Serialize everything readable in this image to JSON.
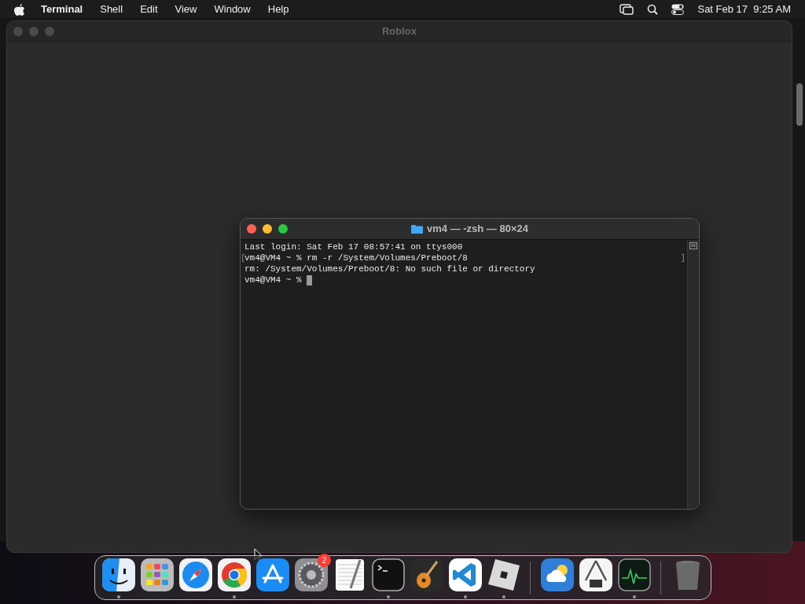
{
  "menu_bar": {
    "app_name": "Terminal",
    "menus": [
      "Shell",
      "Edit",
      "View",
      "Window",
      "Help"
    ],
    "clock": "Sat Feb 17  9:25 AM"
  },
  "background_window": {
    "title": "Roblox"
  },
  "terminal": {
    "title": "vm4 — -zsh — 80×24",
    "cursor": true,
    "lines": [
      {
        "text": "Last login: Sat Feb 17 08:57:41 on ttys000"
      },
      {
        "text": "vm4@VM4 ~ % rm -r /System/Volumes/Preboot/8",
        "open_mark": "[",
        "close_mark": "]"
      },
      {
        "text": "rm: /System/Volumes/Preboot/8: No such file or directory"
      },
      {
        "text": "vm4@VM4 ~ % "
      }
    ]
  },
  "dock": {
    "items": [
      {
        "kind": "finder",
        "running": true
      },
      {
        "kind": "launchpad",
        "running": false
      },
      {
        "kind": "safari",
        "running": false
      },
      {
        "kind": "chrome",
        "running": true
      },
      {
        "kind": "appstore",
        "running": false
      },
      {
        "kind": "settings",
        "running": false,
        "badge": "2"
      },
      {
        "kind": "textedit",
        "running": false
      },
      {
        "kind": "terminal",
        "running": true
      },
      {
        "kind": "garageband",
        "running": false
      },
      {
        "kind": "vscode",
        "running": true
      },
      {
        "kind": "roblox",
        "running": true
      },
      {
        "kind": "separator"
      },
      {
        "kind": "weather",
        "running": false
      },
      {
        "kind": "sysinfo",
        "running": false
      },
      {
        "kind": "activity",
        "running": true
      },
      {
        "kind": "separator"
      },
      {
        "kind": "trash",
        "running": false
      }
    ]
  }
}
